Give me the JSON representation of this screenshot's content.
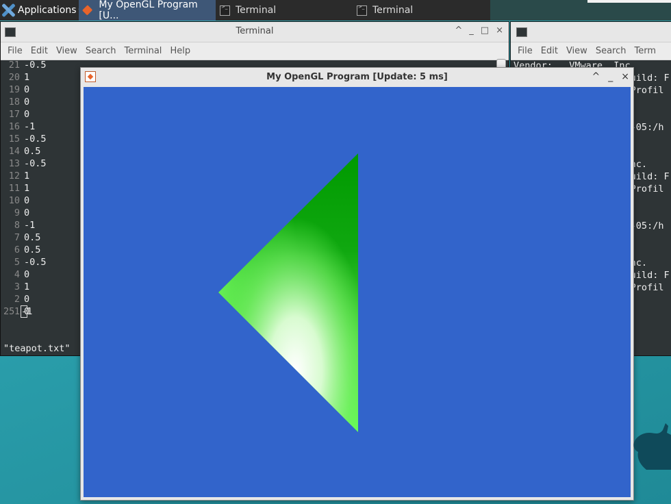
{
  "taskbar": {
    "apps_label": "Applications",
    "caret": "▾",
    "tasks": [
      {
        "label": "My OpenGL Program [U...",
        "active": true
      },
      {
        "label": "Terminal",
        "active": false
      },
      {
        "label": "Terminal",
        "active": false
      }
    ]
  },
  "left_terminal": {
    "title": "Terminal",
    "controls": [
      "^",
      "_",
      "□",
      "×"
    ],
    "menu": [
      "File",
      "Edit",
      "View",
      "Search",
      "Terminal",
      "Help"
    ],
    "lines": [
      {
        "num": "21",
        "text": "-0.5"
      },
      {
        "num": "20",
        "text": "1"
      },
      {
        "num": "19",
        "text": "0"
      },
      {
        "num": "18",
        "text": "0"
      },
      {
        "num": "17",
        "text": "0"
      },
      {
        "num": "16",
        "text": "-1"
      },
      {
        "num": "15",
        "text": "-0.5"
      },
      {
        "num": "14",
        "text": "0.5"
      },
      {
        "num": "13",
        "text": "-0.5"
      },
      {
        "num": "12",
        "text": "1"
      },
      {
        "num": "11",
        "text": "1"
      },
      {
        "num": "10",
        "text": "0"
      },
      {
        "num": "9",
        "text": "0"
      },
      {
        "num": "8",
        "text": "-1"
      },
      {
        "num": "7",
        "text": "0.5"
      },
      {
        "num": "6",
        "text": "0.5"
      },
      {
        "num": "5",
        "text": "-0.5"
      },
      {
        "num": "4",
        "text": "0"
      },
      {
        "num": "3",
        "text": "1"
      },
      {
        "num": "2",
        "text": "0"
      },
      {
        "num": "1",
        "text": "0"
      }
    ],
    "current_line_num": "25",
    "current_line_cursor": "-",
    "current_line_rest": "1",
    "status": "\"teapot.txt\""
  },
  "right_terminal": {
    "menu": [
      "File",
      "Edit",
      "View",
      "Search",
      "Term"
    ],
    "lines": [
      {
        "text": "Vendor:   VMware, Inc."
      },
      {
        "text": "                     uild: F"
      },
      {
        "text": "                     Profil"
      },
      {
        "text": ""
      },
      {
        "text": ""
      },
      {
        "text": "                     -05:/h"
      },
      {
        "text": ""
      },
      {
        "text": ""
      },
      {
        "text": "                     nc."
      },
      {
        "text": "                     uild: F"
      },
      {
        "text": "                     Profil"
      },
      {
        "text": ""
      },
      {
        "text": ""
      },
      {
        "text": "                     -05:/h"
      },
      {
        "text": ""
      },
      {
        "text": ""
      },
      {
        "text": "                     nc."
      },
      {
        "text": "                     uild: F"
      },
      {
        "text": "                     Profil"
      }
    ]
  },
  "gl_window": {
    "title": "My OpenGL Program [Update:  5 ms]",
    "controls": [
      "^",
      "_",
      "×"
    ],
    "background_color": "#3264cb",
    "triangle_colors": {
      "top": "#009a00",
      "left": "#66ee55",
      "bottom": "#ffffff"
    }
  }
}
